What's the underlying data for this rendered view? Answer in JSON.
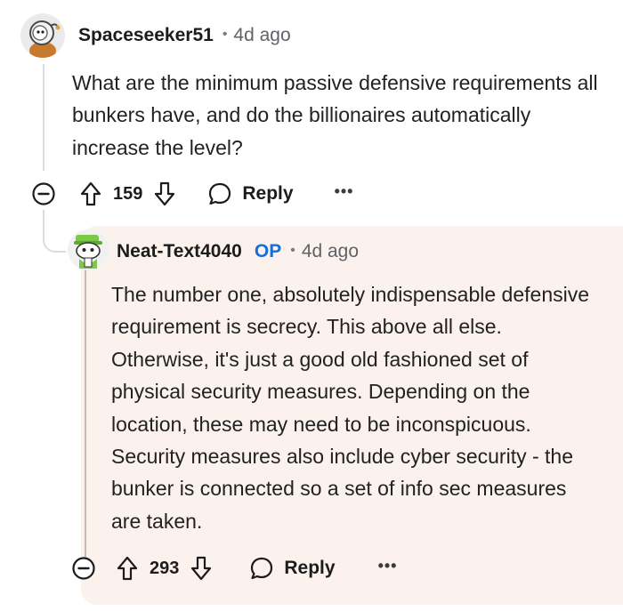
{
  "comment": {
    "username": "Spaceseeker51",
    "separator": "•",
    "time": "4d ago",
    "body": "What are the minimum passive defensive requirements all bunkers have, and do the billionaires automatically increase the level?",
    "actions": {
      "score": "159",
      "reply_label": "Reply",
      "more_label": "•••"
    }
  },
  "reply": {
    "username": "Neat-Text4040",
    "op_badge": "OP",
    "separator": "•",
    "time": "4d ago",
    "body": "The number one, absolutely indispensable defensive requirement is secrecy. This above all else. Otherwise, it's just a good old fashioned set of physical security measures. Depending on the location, these may need to be inconspicuous. Security measures also include cyber security - the bunker is connected so a set of info sec measures are taken.",
    "actions": {
      "score": "293",
      "reply_label": "Reply",
      "more_label": "•••"
    }
  },
  "colors": {
    "op_badge": "#1a6fd6",
    "reply_highlight_bg": "#fbf2ee",
    "thread_line": "#dcdcdc"
  },
  "icons": {
    "collapse": "minus-circle-icon",
    "upvote": "arrow-up-icon",
    "downvote": "arrow-down-icon",
    "reply": "speech-bubble-icon",
    "more": "ellipsis-icon"
  }
}
